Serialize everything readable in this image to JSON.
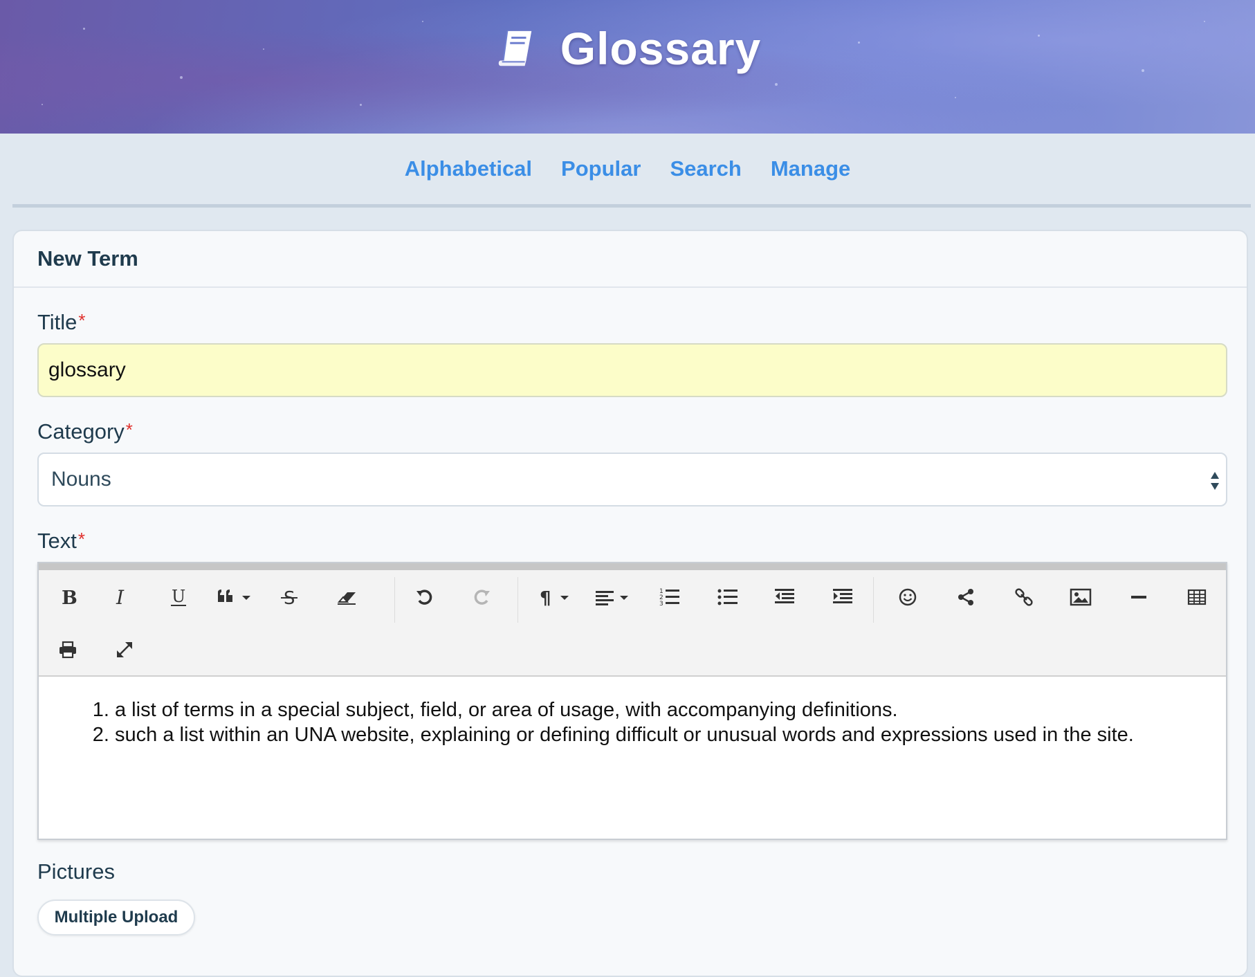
{
  "header": {
    "app_title": "Glossary",
    "icon": "book-icon"
  },
  "nav": {
    "items": [
      {
        "label": "Alphabetical"
      },
      {
        "label": "Popular"
      },
      {
        "label": "Search"
      },
      {
        "label": "Manage"
      }
    ],
    "link_color": "#3b8ee6"
  },
  "form": {
    "heading": "New Term",
    "title_label": "Title",
    "title_value": "glossary",
    "category_label": "Category",
    "category_value": "Nouns",
    "text_label": "Text",
    "required_mark": "*",
    "definitions": [
      "a list of terms in a special subject, field, or area of usage, with accompanying definitions.",
      "such a list within an UNA website, explaining or defining difficult or unusual words and expressions used in the site."
    ],
    "pictures_label": "Pictures",
    "upload_button": "Multiple Upload"
  },
  "toolbar": {
    "buttons": [
      "bold-icon",
      "italic-icon",
      "underline-icon",
      "blockquote-icon",
      "strikethrough-icon",
      "eraser-icon",
      "undo-icon",
      "redo-icon",
      "paragraph-icon",
      "align-left-icon",
      "ordered-list-icon",
      "unordered-list-icon",
      "outdent-icon",
      "indent-icon",
      "emoji-icon",
      "share-icon",
      "link-icon",
      "image-icon",
      "horizontal-rule-icon",
      "table-icon",
      "print-icon",
      "fullscreen-icon"
    ]
  },
  "colors": {
    "required": "#e0302c",
    "title_input_bg": "#fcfdc9",
    "page_bg": "#e0e8f0"
  }
}
